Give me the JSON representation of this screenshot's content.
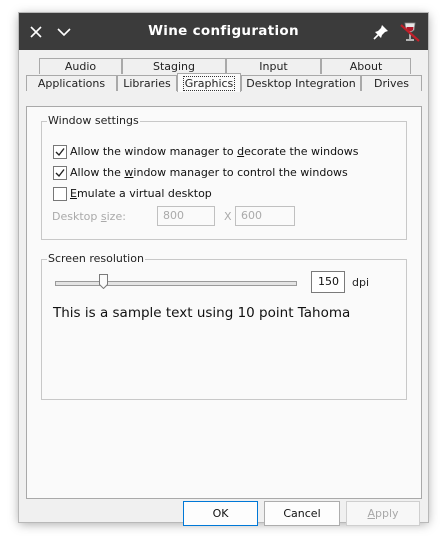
{
  "window": {
    "title": "Wine configuration",
    "icons": {
      "close": "close-icon",
      "menu": "chevron-down-icon",
      "pin": "pin-icon",
      "app": "wine-glass-icon"
    }
  },
  "tabs": {
    "row_top": [
      "Audio",
      "Staging",
      "Input",
      "About"
    ],
    "row_bottom": [
      "Applications",
      "Libraries",
      "Graphics",
      "Desktop Integration",
      "Drives"
    ],
    "active": "Graphics"
  },
  "window_settings": {
    "title": "Window settings",
    "decorate": {
      "prefix": "Allow the window manager to ",
      "key": "d",
      "suffix": "ecorate the windows",
      "checked": true
    },
    "control": {
      "prefix": "Allow the ",
      "key": "w",
      "suffix": "indow manager to control the windows",
      "checked": true
    },
    "virtual_desktop": {
      "prefix": "",
      "key": "E",
      "suffix": "mulate a virtual desktop",
      "checked": false
    },
    "desktop_size": {
      "prefix": "Desktop ",
      "key": "s",
      "suffix": "ize:"
    },
    "width": "800",
    "separator": "X",
    "height": "600"
  },
  "screen_resolution": {
    "title": "Screen resolution",
    "dpi_value": "150",
    "dpi_unit": "dpi",
    "slider_fraction": 0.2,
    "sample_text": "This is a sample text using 10 point Tahoma"
  },
  "footer": {
    "ok": "OK",
    "cancel": "Cancel",
    "apply_key": "A",
    "apply_rest": "pply"
  }
}
